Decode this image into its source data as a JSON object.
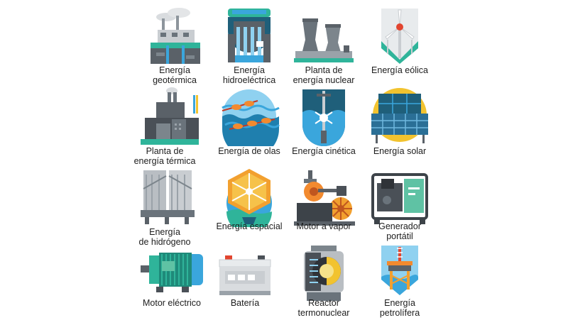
{
  "tiles": [
    {
      "label": "Energía\ngeotérmica",
      "icon": "geothermal-plant-icon"
    },
    {
      "label": "Energía\nhidroeléctrica",
      "icon": "hydroelectric-dam-icon"
    },
    {
      "label": "Planta de\nenergía nuclear",
      "icon": "nuclear-cooling-towers-icon"
    },
    {
      "label": "Energía eólica",
      "icon": "wind-turbine-icon"
    },
    {
      "label": "Planta de\nenergía térmica",
      "icon": "thermal-power-plant-icon"
    },
    {
      "label": "Energía de olas",
      "icon": "wave-energy-icon"
    },
    {
      "label": "Energía cinética",
      "icon": "kinetic-energy-icon"
    },
    {
      "label": "Energía solar",
      "icon": "solar-panel-icon"
    },
    {
      "label": "Energía\nde hidrógeno",
      "icon": "hydrogen-tanks-icon"
    },
    {
      "label": "Energía espacial",
      "icon": "space-solar-satellite-icon"
    },
    {
      "label": "Motor a vapor",
      "icon": "steam-engine-icon"
    },
    {
      "label": "Generador\nportátil",
      "icon": "portable-generator-icon"
    },
    {
      "label": "Motor eléctrico",
      "icon": "electric-motor-icon"
    },
    {
      "label": "Batería",
      "icon": "battery-icon"
    },
    {
      "label": "Reactor\ntermonuclear",
      "icon": "thermonuclear-reactor-icon"
    },
    {
      "label": "Energía\npetrolífera",
      "icon": "oil-platform-icon"
    }
  ]
}
